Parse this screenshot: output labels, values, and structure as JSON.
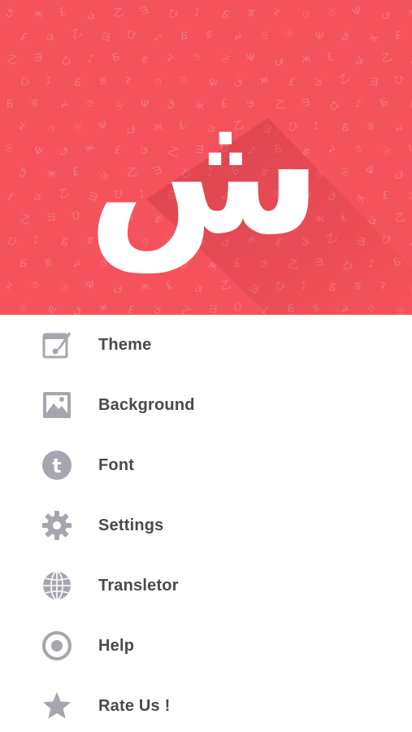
{
  "header": {
    "logo_glyph": "ش",
    "background_color": "#f4525c",
    "glyph_color": "#ffffff",
    "pattern_glyphs": [
      "ق",
      "ж",
      "£",
      "ئ",
      "乙",
      "ヨ",
      "ひ",
      "♪",
      "Б",
      "ङ",
      "ᖨ",
      "ও",
      "ত",
      "Ψ"
    ]
  },
  "menu": {
    "icon_color": "#a7a6ae",
    "text_color": "#4a4a4a",
    "items": [
      {
        "label": "Theme",
        "icon": "theme-icon"
      },
      {
        "label": "Background",
        "icon": "image-icon"
      },
      {
        "label": "Font",
        "icon": "font-icon"
      },
      {
        "label": "Settings",
        "icon": "gear-icon"
      },
      {
        "label": "Transletor",
        "icon": "globe-icon"
      },
      {
        "label": "Help",
        "icon": "help-icon"
      },
      {
        "label": "Rate Us !",
        "icon": "star-icon"
      }
    ]
  }
}
